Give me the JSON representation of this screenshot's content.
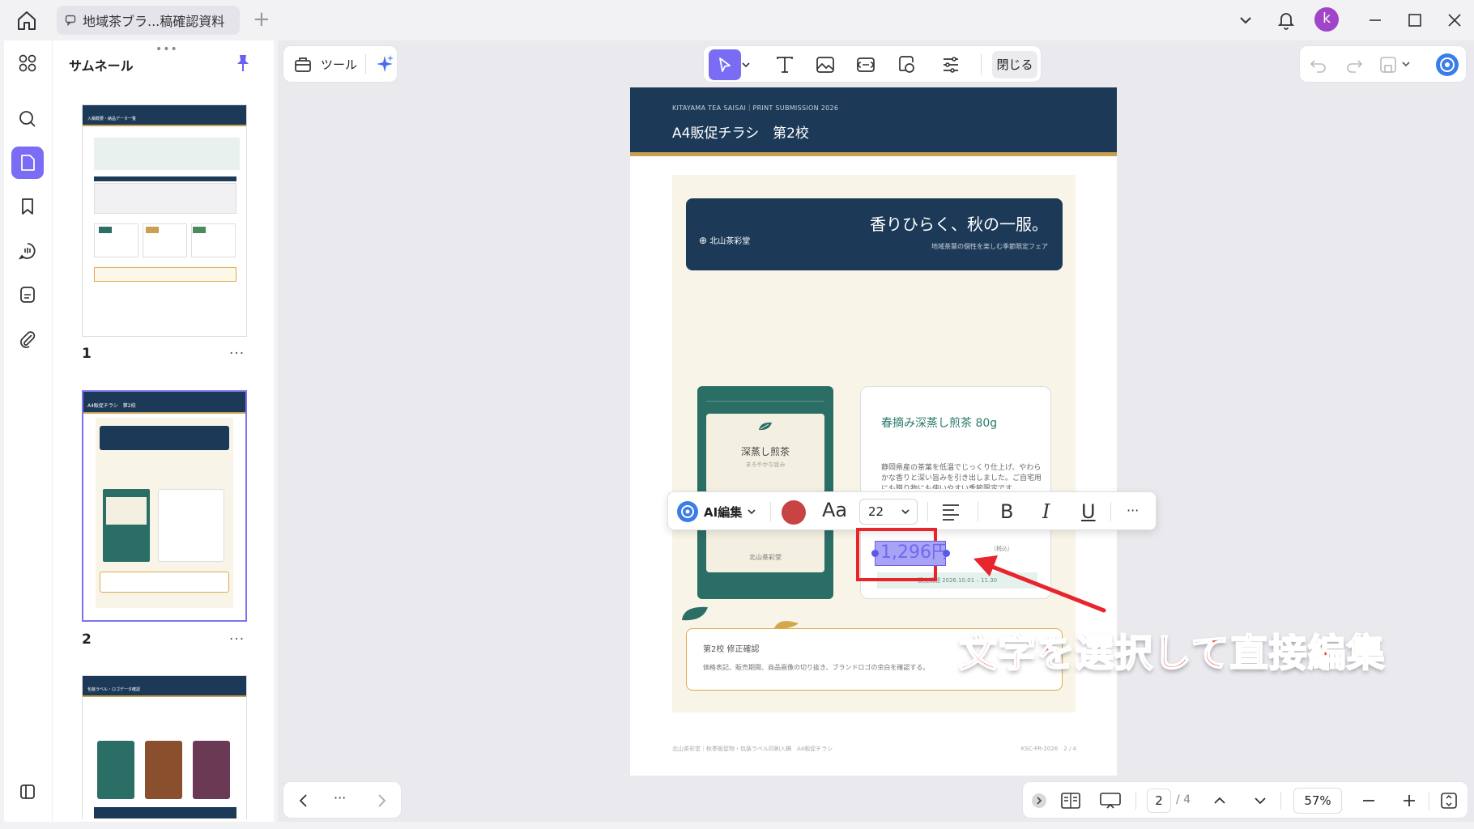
{
  "titlebar": {
    "tab_title": "地域茶ブラ...稿確認資料",
    "tab_add": "+",
    "avatar_letter": "k"
  },
  "sidebar": {
    "panel_title": "サムネール",
    "grip": "•••",
    "pages": [
      {
        "number": "1",
        "more": "···",
        "header": "入稿概要・納品データ一覧"
      },
      {
        "number": "2",
        "more": "···",
        "header": "A4販促チラシ　第2校"
      },
      {
        "header": "包装ラベル・ロゴデータ確認"
      }
    ]
  },
  "toolbar": {
    "tools_label": "ツール",
    "close_label": "閉じる"
  },
  "document": {
    "header_small": "KITAYAMA TEA SAISAI｜PRINT SUBMISSION 2026",
    "header_title": "A4販促チラシ　第2校",
    "banner_title": "香りひらく、秋の一服。",
    "banner_subtitle": "地域茶葉の個性を楽しむ季節限定フェア",
    "banner_brand": "北山茶彩堂",
    "package_title": "深蒸し煎茶",
    "package_sub": "まろやかな旨み",
    "package_brand": "北山茶彩堂",
    "product_title": "春摘み深蒸し煎茶 80g",
    "product_desc": "静岡県産の茶葉を低温でじっくり仕上げ、やわらかな香りと深い旨みを引き出しました。ご自宅用にも贈り物にも使いやすい季節限定です。",
    "price": "1,296円",
    "tax_note": "（税込）",
    "date_note": "販売期間 2026.10.01 – 11.30",
    "review_title": "第2校 修正確認",
    "review_desc": "価格表記、販売期間、商品画像の切り抜き、ブランドロゴの余白を確認する。",
    "footer_left": "北山茶彩堂｜秋季販促物・包装ラベル印刷入稿　A4販促チラシ",
    "footer_right": "KSC-PR-2026　2 / 4"
  },
  "format_bar": {
    "ai_label": "AI編集",
    "font_icon_label": "Aa",
    "font_size": "22",
    "bold": "B",
    "italic": "I",
    "underline": "U",
    "more": "···",
    "text_color": "#c84444"
  },
  "annotation": {
    "callout": "文字を選択して直接編集"
  },
  "navigation": {
    "more": "···"
  },
  "status": {
    "current_page": "2",
    "total_pages": "/ 4",
    "zoom": "57%"
  },
  "colors": {
    "accent": "#7a6cf5",
    "doc_navy": "#1c3a57",
    "doc_green": "#2a6e66",
    "callout_red": "#ee2b2b"
  }
}
